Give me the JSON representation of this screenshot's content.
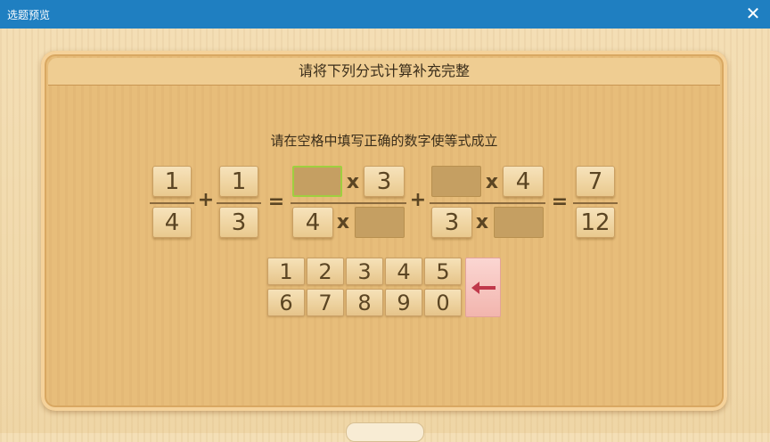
{
  "window": {
    "title": "选题预览",
    "close_glyph": "✕"
  },
  "board": {
    "header": "请将下列分式计算补充完整",
    "instruction": "请在空格中填写正确的数字使等式成立"
  },
  "equation": {
    "frac1": {
      "numerator": "1",
      "denominator": "4"
    },
    "plus1": "+",
    "frac2": {
      "numerator": "1",
      "denominator": "3"
    },
    "equals1": "=",
    "frac3": {
      "numerator_multiplier": "3",
      "denominator_base": "4",
      "times": "x"
    },
    "plus2": "+",
    "frac4": {
      "numerator_multiplier": "4",
      "denominator_base": "3",
      "times": "x"
    },
    "equals2": "=",
    "result": {
      "numerator": "7",
      "denominator": "12"
    }
  },
  "keypad": {
    "row1": [
      "1",
      "2",
      "3",
      "4",
      "5"
    ],
    "row2": [
      "6",
      "7",
      "8",
      "9",
      "0"
    ],
    "backspace_icon": "left-arrow-icon"
  },
  "colors": {
    "titlebar": "#1f7fc1",
    "board": "#e7bd7a",
    "slot": "#c59f62",
    "slot_active_border": "#9fcf3f",
    "backspace": "#f2b5ae",
    "arrow": "#c0394b"
  }
}
